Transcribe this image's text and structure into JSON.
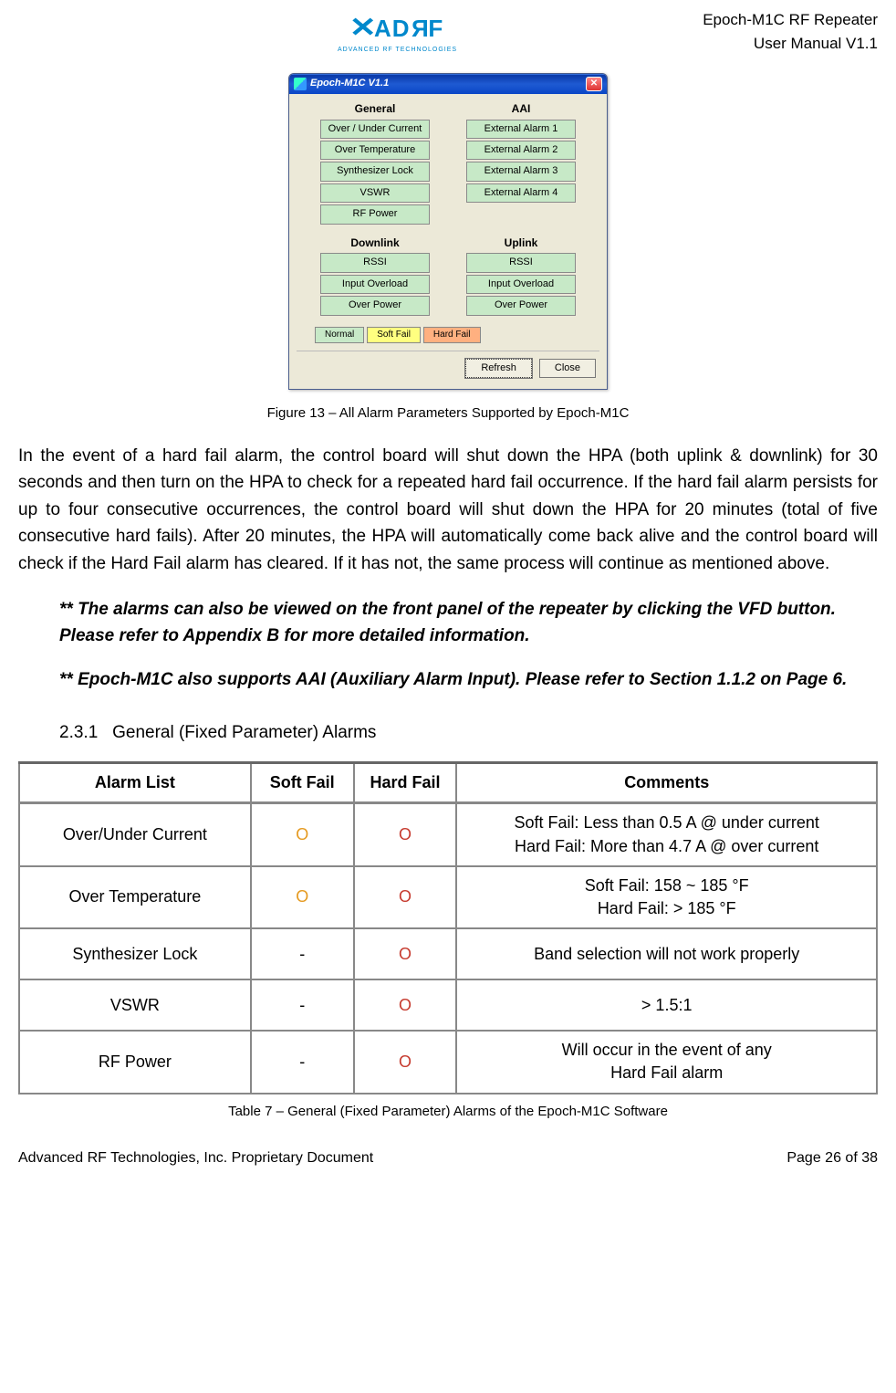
{
  "header": {
    "logo_main": "ADRF",
    "logo_sub": "ADVANCED RF TECHNOLOGIES",
    "right1": "Epoch-M1C RF Repeater",
    "right2": "User Manual V1.1"
  },
  "window": {
    "title": "Epoch-M1C V1.1",
    "col_general": "General",
    "col_aai": "AAI",
    "general_items": [
      "Over / Under Current",
      "Over Temperature",
      "Synthesizer Lock",
      "VSWR",
      "RF Power"
    ],
    "aai_items": [
      "External Alarm 1",
      "External Alarm 2",
      "External Alarm 3",
      "External Alarm 4"
    ],
    "col_downlink": "Downlink",
    "col_uplink": "Uplink",
    "dl_items": [
      "RSSI",
      "Input Overload",
      "Over Power"
    ],
    "ul_items": [
      "RSSI",
      "Input Overload",
      "Over Power"
    ],
    "legend_normal": "Normal",
    "legend_soft": "Soft Fail",
    "legend_hard": "Hard Fail",
    "btn_refresh": "Refresh",
    "btn_close": "Close"
  },
  "fig_caption": "Figure 13 – All Alarm Parameters Supported by Epoch-M1C",
  "para1": "In the event of a hard fail alarm, the control board will shut down the HPA (both uplink & downlink) for 30 seconds and then turn on the HPA to check for a repeated hard fail occurrence.  If the hard fail alarm persists for up to four consecutive occurrences, the control board will shut down the HPA for 20 minutes (total of five consecutive hard fails).  After 20 minutes, the HPA will automatically come back alive and the control board will check if the Hard Fail alarm has cleared.  If it has not, the same process will continue as mentioned above.",
  "note1": "** The alarms can also be viewed on the front panel of the repeater by clicking the VFD button.  Please refer to Appendix B for more detailed information.",
  "note2": "** Epoch-M1C also supports AAI (Auxiliary Alarm Input).  Please refer to Section 1.1.2 on Page 6.",
  "section_num": "2.3.1",
  "section_title": "General (Fixed Parameter) Alarms",
  "table": {
    "h1": "Alarm List",
    "h2": "Soft Fail",
    "h3": "Hard Fail",
    "h4": "Comments",
    "rows": [
      {
        "a": "Over/Under Current",
        "sf": "O",
        "hf": "O",
        "c1": "Soft Fail: Less than 0.5 A @ under current",
        "c2": "Hard Fail: More than 4.7 A @ over current"
      },
      {
        "a": "Over Temperature",
        "sf": "O",
        "hf": "O",
        "c1": "Soft Fail: 158 ~ 185 °F",
        "c2": "Hard Fail: > 185  °F"
      },
      {
        "a": "Synthesizer Lock",
        "sf": "-",
        "hf": "O",
        "c1": "Band selection will not work properly",
        "c2": ""
      },
      {
        "a": "VSWR",
        "sf": "-",
        "hf": "O",
        "c1": "> 1.5:1",
        "c2": ""
      },
      {
        "a": "RF Power",
        "sf": "-",
        "hf": "O",
        "c1": "Will occur in the event of any",
        "c2": "Hard Fail alarm"
      }
    ]
  },
  "table_caption": "Table 7 – General (Fixed Parameter) Alarms of the Epoch-M1C Software",
  "footer": {
    "left": "Advanced RF Technologies, Inc. Proprietary Document",
    "right": "Page 26 of 38"
  }
}
